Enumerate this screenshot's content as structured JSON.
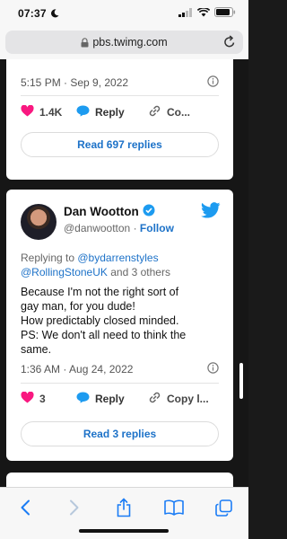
{
  "status_bar": {
    "time": "07:37",
    "icons": [
      "moon-icon",
      "signal-icon",
      "wifi-icon",
      "battery-icon"
    ]
  },
  "browser": {
    "url": "pbs.twimg.com",
    "icons": [
      "lock-icon",
      "reload-icon"
    ]
  },
  "tweet_prev": {
    "timestamp": "5:15 PM · Sep 9, 2022",
    "likes": "1.4K",
    "reply_label": "Reply",
    "copy_label": "Co...",
    "replies_button": "Read 697 replies"
  },
  "tweet_main": {
    "name": "Dan Wootton",
    "handle": "@danwootton",
    "separator": " · ",
    "follow_label": "Follow",
    "replying_prefix": "Replying to ",
    "replying_user1": "@bydarrenstyles",
    "replying_user2": "@RollingStoneUK",
    "replying_suffix": " and 3 others",
    "body_lines": [
      "Because I'm not the right sort of",
      "gay man, for you dude!",
      "How predictably closed minded.",
      "PS: We don't all need to think the",
      "same."
    ],
    "timestamp": "1:36 AM · Aug 24, 2022",
    "likes": "3",
    "reply_label": "Reply",
    "copy_label": "Copy l...",
    "replies_button": "Read 3 replies"
  },
  "toolbar": {
    "items": [
      "back-icon",
      "forward-icon",
      "share-icon",
      "bookmarks-icon",
      "tabs-icon"
    ]
  },
  "colors": {
    "accent_blue": "#1d9bf0",
    "link_blue": "#1d72c8",
    "like_pink": "#f91880",
    "page_background": "#161616"
  }
}
